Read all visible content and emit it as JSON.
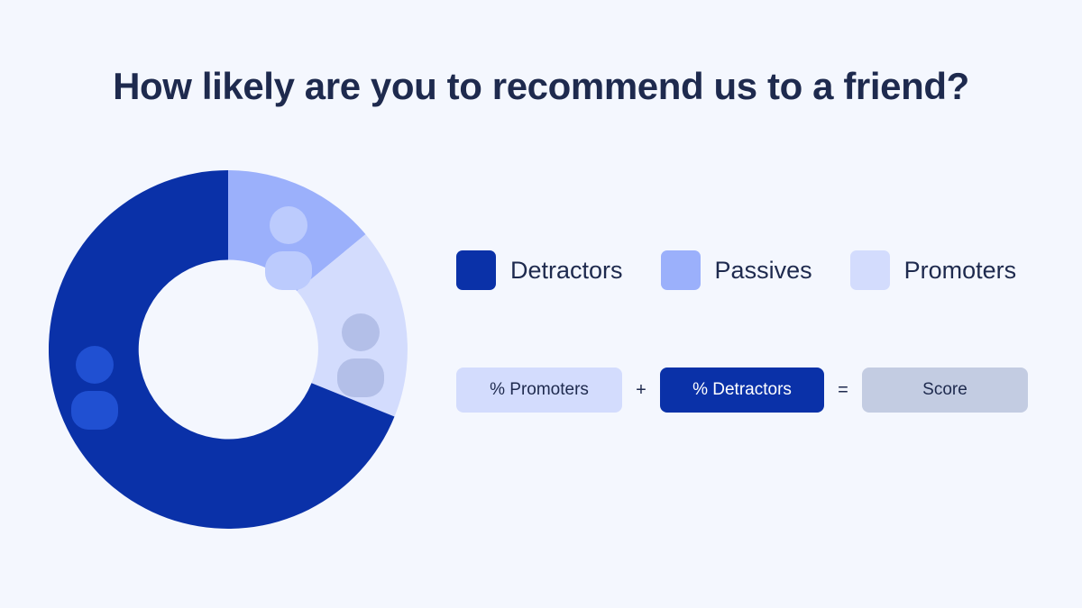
{
  "page": {
    "title": "How likely are you to recommend us to a friend?",
    "background_color": "#f4f7fe",
    "text_color": "#1e2a4e"
  },
  "legend": {
    "items": [
      {
        "label": "Detractors",
        "color": "#0a31a8",
        "icon": "square-swatch-icon"
      },
      {
        "label": "Passives",
        "color": "#9bb0fb",
        "icon": "square-swatch-icon"
      },
      {
        "label": "Promoters",
        "color": "#d3dcfd",
        "icon": "square-swatch-icon"
      }
    ]
  },
  "formula": {
    "promoters_label": "% Promoters",
    "plus_operator": "+",
    "detractors_label": "% Detractors",
    "equals_operator": "=",
    "score_label": "Score",
    "promoters_color": "#d3dcfd",
    "detractors_color": "#0a31a8",
    "score_color": "#c3cce2"
  },
  "chart_data": {
    "type": "pie",
    "title": "How likely are you to recommend us to a friend?",
    "variant": "donut",
    "categories": [
      "Passives",
      "Promoters",
      "Detractors"
    ],
    "values": [
      14,
      17,
      69
    ],
    "value_unit": "percent",
    "colors": [
      "#9bb0fb",
      "#d3dcfd",
      "#0a31a8"
    ],
    "start_angle_deg": 0,
    "direction": "clockwise",
    "inner_radius_ratio": 0.5,
    "labels_shown": false,
    "legend": "right",
    "segments": [
      {
        "name": "Passives",
        "value": 14,
        "color": "#9bb0fb",
        "start_deg": 0,
        "end_deg": 50,
        "icon": "person-icon",
        "icon_color": "#bccbfd"
      },
      {
        "name": "Promoters",
        "value": 17,
        "color": "#d3dcfd",
        "start_deg": 50,
        "end_deg": 112,
        "icon": "person-icon",
        "icon_color": "#b3bfe8"
      },
      {
        "name": "Detractors",
        "value": 69,
        "color": "#0a31a8",
        "start_deg": 112,
        "end_deg": 360,
        "icon": "person-icon",
        "icon_color": "#2050d2"
      }
    ]
  }
}
